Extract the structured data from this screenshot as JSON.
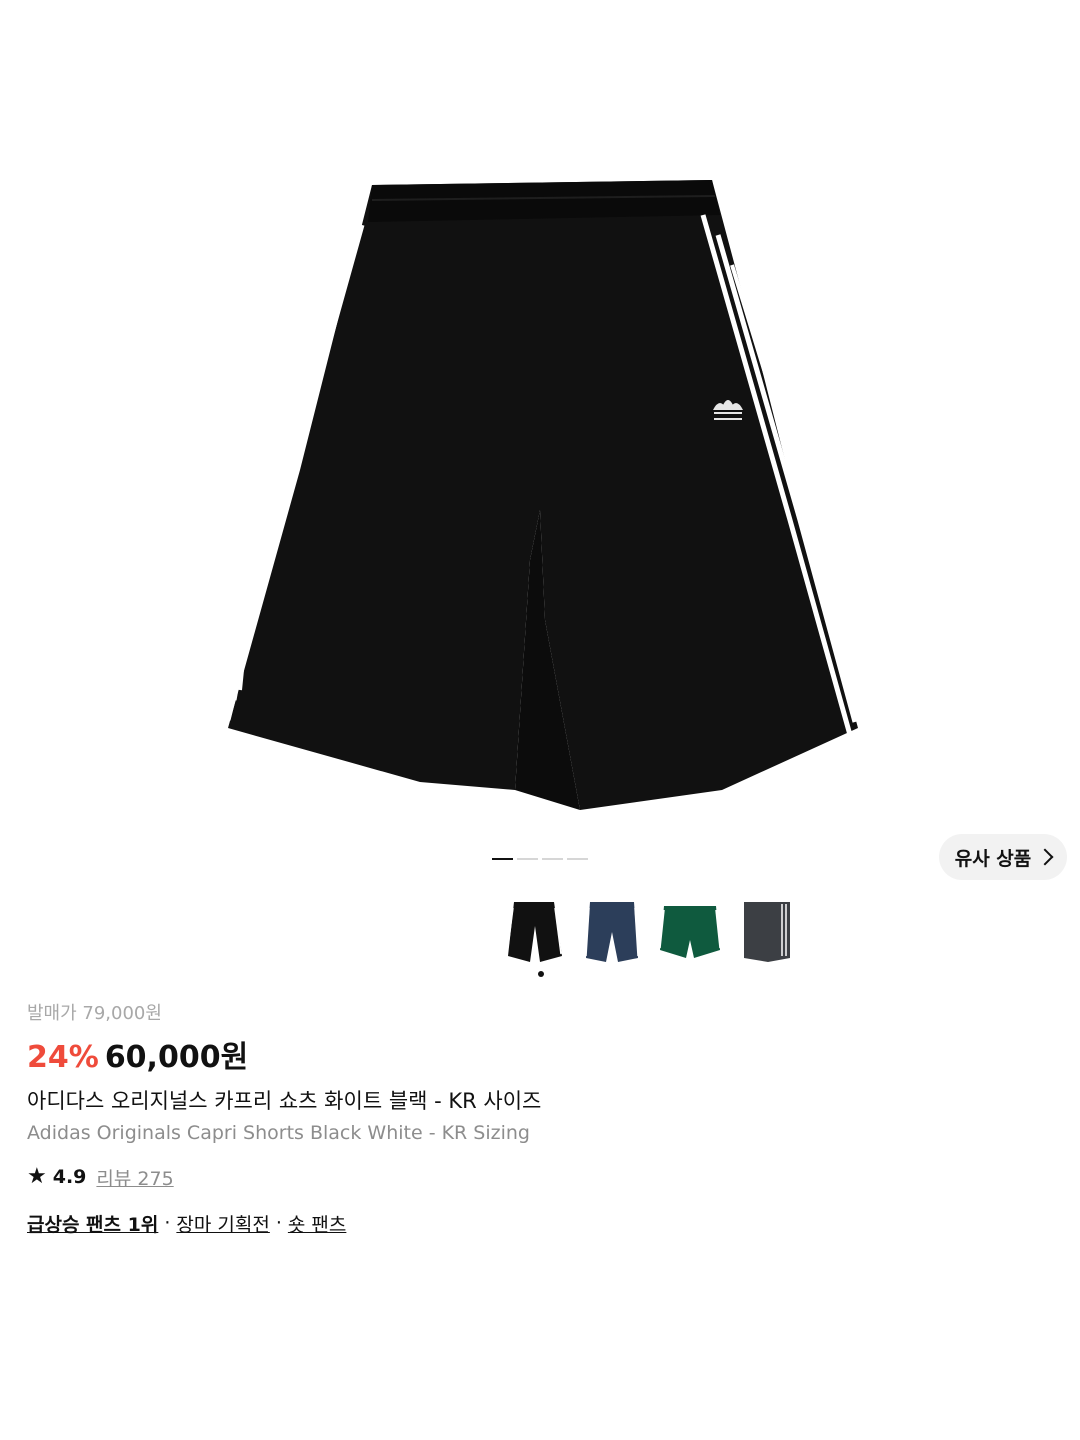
{
  "gallery": {
    "image_alt": "Adidas Originals Capri Shorts Black White",
    "page_count": 4,
    "active_page": 1,
    "similar_button_label": "유사 상품"
  },
  "color_options": [
    {
      "name": "black",
      "color": "#111111",
      "stripe": "#ffffff",
      "selected": true
    },
    {
      "name": "navy",
      "color": "#2c3e5a",
      "stripe": "#ffffff",
      "selected": false
    },
    {
      "name": "green",
      "color": "#0f5a3e",
      "stripe": "#ffffff",
      "selected": false
    },
    {
      "name": "grey",
      "color": "#3c3f44",
      "stripe": "#ffffff",
      "selected": false
    }
  ],
  "product": {
    "original_price": "발매가 79,000원",
    "discount": "24%",
    "price": "60,000원",
    "title_ko": "아디다스 오리지널스 카프리 쇼츠 화이트 블랙 - KR 사이즈",
    "title_en": "Adidas Originals Capri Shorts Black White - KR Sizing",
    "rating": "4.9",
    "review_label": "리뷰 275",
    "tags": [
      {
        "label": "급상승 팬츠 1위"
      },
      {
        "label": "장마 기획전"
      },
      {
        "label": "숏 팬츠"
      }
    ],
    "separator": "·"
  },
  "colors": {
    "discount": "#ef4b3b",
    "muted": "#8d8d8d",
    "text": "#111111"
  }
}
